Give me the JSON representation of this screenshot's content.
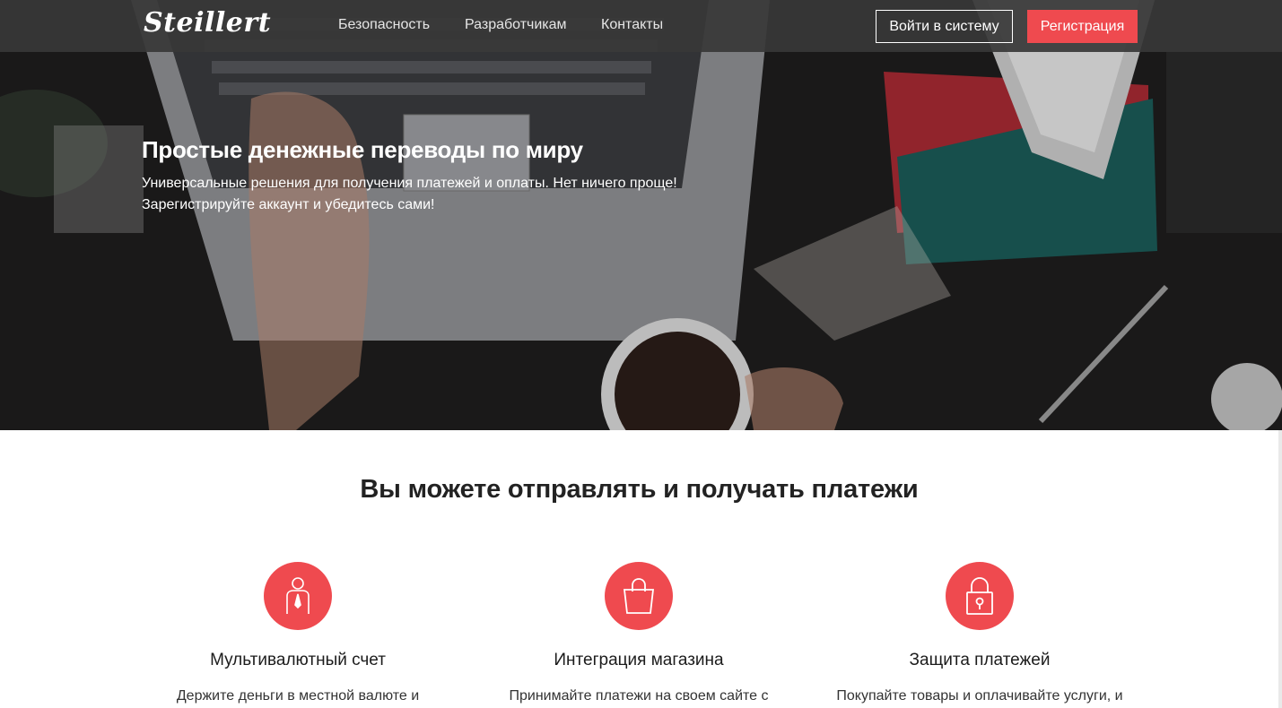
{
  "brand": {
    "logo_text": "Steillert",
    "accent_color": "#ef4a4f"
  },
  "nav": {
    "links": [
      "Безопасность",
      "Разработчикам",
      "Контакты"
    ],
    "login_label": "Войти в систему",
    "register_label": "Регистрация"
  },
  "hero": {
    "title": "Простые денежные переводы по миру",
    "subtitle_line1": "Универсальные решения для получения платежей и оплаты. Нет ничего проще!",
    "subtitle_line2": "Зарегистрируйте аккаунт и убедитесь сами!"
  },
  "features": {
    "title": "Вы можете отправлять и получать платежи",
    "items": [
      {
        "icon": "person-icon",
        "title": "Мультивалютный счет",
        "text": "Держите деньги в местной валюте и"
      },
      {
        "icon": "shopping-bag-icon",
        "title": "Интеграция магазина",
        "text": "Принимайте платежи на своем сайте с"
      },
      {
        "icon": "padlock-icon",
        "title": "Защита платежей",
        "text": "Покупайте товары и оплачивайте услуги, и"
      }
    ]
  }
}
